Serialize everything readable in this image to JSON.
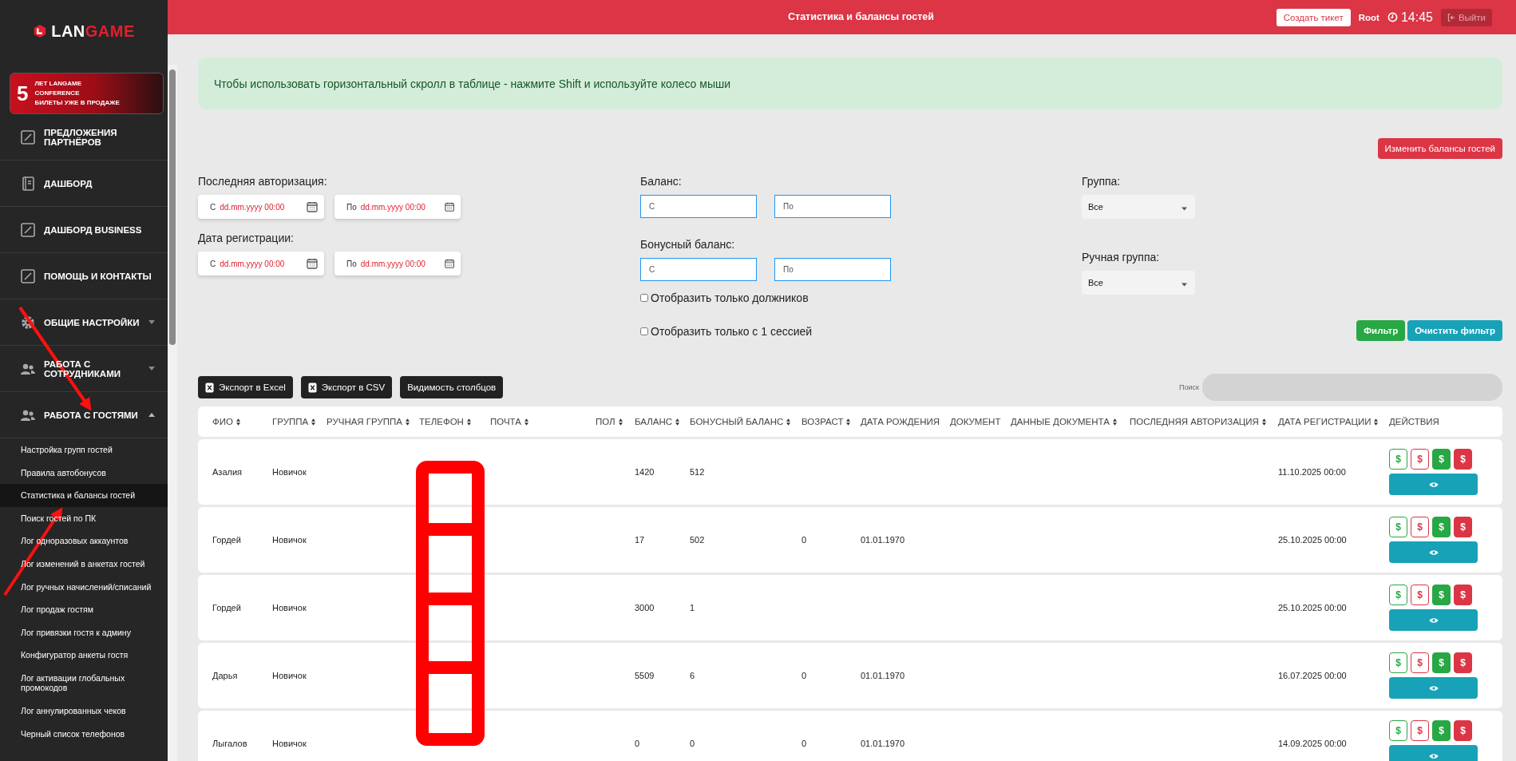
{
  "sidebar": {
    "logo": {
      "parts": [
        "LAN",
        "GAME"
      ]
    },
    "banner": {
      "number": "5",
      "lines": [
        "ЛЕТ LANGAME",
        "CONFERENCE",
        "БИЛЕТЫ УЖЕ В ПРОДАЖЕ"
      ]
    },
    "items": [
      {
        "label": "ПРЕДЛОЖЕНИЯ ПАРТНЁРОВ"
      },
      {
        "label": "ДАШБОРД"
      },
      {
        "label": "ДАШБОРД BUSINESS"
      },
      {
        "label": "ПОМОЩЬ И КОНТАКТЫ"
      },
      {
        "label": "ОБЩИЕ НАСТРОЙКИ",
        "expanded": false
      },
      {
        "label": "РАБОТА С СОТРУДНИКАМИ",
        "expanded": false
      },
      {
        "label": "РАБОТА С ГОСТЯМИ",
        "expanded": true,
        "children": [
          {
            "label": "Настройка групп гостей",
            "selected": false
          },
          {
            "label": "Правила автобонусов",
            "selected": false
          },
          {
            "label": "Статистика и балансы гостей",
            "selected": true
          },
          {
            "label": "Поиск гостей по ПК",
            "selected": false
          },
          {
            "label": "Лог одноразовых аккаунтов",
            "selected": false
          },
          {
            "label": "Лог изменений в анкетах гостей",
            "selected": false
          },
          {
            "label": "Лог ручных начислений/списаний",
            "selected": false
          },
          {
            "label": "Лог продаж гостям",
            "selected": false
          },
          {
            "label": "Лог привязки гостя к админу",
            "selected": false
          },
          {
            "label": "Конфигуратор анкеты гостя",
            "selected": false
          },
          {
            "label": "Лог активации глобальных промокодов",
            "selected": false
          },
          {
            "label": "Лог аннулированных чеков",
            "selected": false
          },
          {
            "label": "Черный список телефонов",
            "selected": false
          }
        ]
      }
    ]
  },
  "header": {
    "title": "Статистика и балансы гостей",
    "create_ticket": "Создать тикет",
    "user": "Root",
    "time": "14:45",
    "logout": "Выйти"
  },
  "alert": "Чтобы использовать горизонтальный скролл в таблице - нажмите Shift и используйте колесо мыши",
  "change_balances": "Изменить балансы гостей",
  "filters": {
    "last_auth": {
      "label": "Последняя авторизация:",
      "from": {
        "prefix": "С",
        "placeholder": "dd.mm.yyyy 00:00"
      },
      "to": {
        "prefix": "По",
        "placeholder": "dd.mm.yyyy 00:00"
      }
    },
    "registration": {
      "label": "Дата регистрации:",
      "from": {
        "prefix": "С",
        "placeholder": "dd.mm.yyyy 00:00"
      },
      "to": {
        "prefix": "По",
        "placeholder": "dd.mm.yyyy 00:00"
      }
    },
    "balance": {
      "label": "Баланс:",
      "from": {
        "placeholder": "С"
      },
      "to": {
        "placeholder": "По"
      }
    },
    "bonus_balance": {
      "label": "Бонусный баланс:",
      "from": {
        "placeholder": "С"
      },
      "to": {
        "placeholder": "По"
      }
    },
    "checkboxes": [
      {
        "label": "Отобразить только должников",
        "checked": false
      },
      {
        "label": "Отобразить только с 1 сессией",
        "checked": false
      }
    ],
    "group": {
      "label": "Группа:",
      "value": "Все"
    },
    "manual_group": {
      "label": "Ручная группа:",
      "value": "Все"
    },
    "filter_button": "Фильтр",
    "clear_button": "Очистить фильтр"
  },
  "toolbar": {
    "buttons": [
      {
        "label": "Экспорт в Excel",
        "kind": "file"
      },
      {
        "label": "Экспорт в CSV",
        "kind": "file"
      },
      {
        "label": "Видимость столбцов",
        "kind": "plain"
      }
    ],
    "search_label": "Поиск"
  },
  "table": {
    "columns": [
      {
        "label": "ФИО",
        "sortable": true
      },
      {
        "label": "ГРУППА",
        "sortable": true
      },
      {
        "label": "РУЧНАЯ ГРУППА",
        "sortable": true
      },
      {
        "label": "ТЕЛЕФОН",
        "sortable": true
      },
      {
        "label": "ПОЧТА",
        "sortable": true
      },
      {
        "label": "ПОЛ",
        "sortable": true
      },
      {
        "label": "БАЛАНС",
        "sortable": true
      },
      {
        "label": "БОНУСНЫЙ БАЛАНС",
        "sortable": true
      },
      {
        "label": "ВОЗРАСТ",
        "sortable": true
      },
      {
        "label": "ДАТА РОЖДЕНИЯ",
        "sortable": false
      },
      {
        "label": "ДОКУМЕНТ",
        "sortable": false
      },
      {
        "label": "ДАННЫЕ ДОКУМЕНТА",
        "sortable": true
      },
      {
        "label": "ПОСЛЕДНЯЯ АВТОРИЗАЦИЯ",
        "sortable": true
      },
      {
        "label": "ДАТА РЕГИСТРАЦИИ",
        "sortable": true
      },
      {
        "label": "ДЕЙСТВИЯ",
        "sortable": false
      }
    ],
    "rows": [
      {
        "fio": "Азалия",
        "group": "Новичок",
        "balance": "1420",
        "bonus_balance": "512",
        "registered": "11.10.2025 00:00",
        "actions": [
          {
            "label": "$",
            "kind": "outline-success"
          },
          {
            "label": "$",
            "kind": "outline-danger"
          },
          {
            "label": "$",
            "kind": "success"
          },
          {
            "label": "$",
            "kind": "danger"
          }
        ]
      },
      {
        "fio": "Гордей",
        "group": "Новичок",
        "balance": "17",
        "bonus_balance": "502",
        "age": "0",
        "birth_date": "01.01.1970",
        "registered": "25.10.2025 00:00",
        "actions": [
          {
            "label": "$",
            "kind": "outline-success"
          },
          {
            "label": "$",
            "kind": "outline-danger"
          },
          {
            "label": "$",
            "kind": "success"
          },
          {
            "label": "$",
            "kind": "danger"
          }
        ]
      },
      {
        "fio": "Гордей",
        "group": "Новичок",
        "balance": "3000",
        "bonus_balance": "1",
        "registered": "25.10.2025 00:00",
        "actions": [
          {
            "label": "$",
            "kind": "outline-success"
          },
          {
            "label": "$",
            "kind": "outline-danger"
          },
          {
            "label": "$",
            "kind": "success"
          },
          {
            "label": "$",
            "kind": "danger"
          }
        ]
      },
      {
        "fio": "Дарья",
        "group": "Новичок",
        "balance": "5509",
        "bonus_balance": "6",
        "age": "0",
        "birth_date": "01.01.1970",
        "registered": "16.07.2025 00:00",
        "actions": [
          {
            "label": "$",
            "kind": "outline-success"
          },
          {
            "label": "$",
            "kind": "outline-danger"
          },
          {
            "label": "$",
            "kind": "success"
          },
          {
            "label": "$",
            "kind": "danger"
          }
        ]
      },
      {
        "fio": "Лыгалов",
        "group": "Новичок",
        "balance": "0",
        "bonus_balance": "0",
        "age": "0",
        "birth_date": "01.01.1970",
        "registered": "14.09.2025 00:00",
        "actions": [
          {
            "label": "$",
            "kind": "outline-success"
          },
          {
            "label": "$",
            "kind": "outline-danger"
          },
          {
            "label": "$",
            "kind": "success"
          },
          {
            "label": "$",
            "kind": "danger"
          }
        ]
      }
    ]
  }
}
